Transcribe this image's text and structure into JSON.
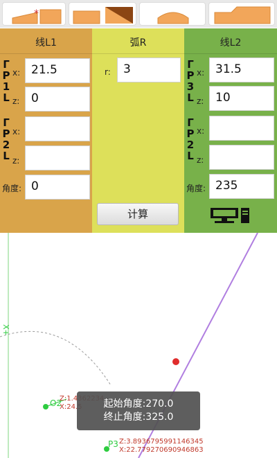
{
  "tabs": [
    {
      "name": "tab-line-chamfer",
      "marker": "*"
    },
    {
      "name": "tab-dual-chamfer"
    },
    {
      "name": "tab-arc"
    },
    {
      "name": "tab-step-chamfer"
    }
  ],
  "panel_l1": {
    "title": "线L1",
    "vertical_p1": [
      "Γ",
      "P",
      "1",
      "L"
    ],
    "vertical_p2": [
      "Γ",
      "P",
      "2",
      "L"
    ],
    "fields": {
      "x1_label": "x:",
      "x1_value": "21.5",
      "z1_label": "z:",
      "z1_value": "0",
      "x2_label": "x:",
      "x2_value": "",
      "z2_label": "z:",
      "z2_value": "",
      "angle_label": "角度:",
      "angle_value": "0"
    }
  },
  "panel_r": {
    "title": "弧R",
    "r_label": "r:",
    "r_value": "3",
    "calc_label": "计算"
  },
  "panel_l2": {
    "title": "线L2",
    "vertical_p3": [
      "Γ",
      "P",
      "3",
      "L"
    ],
    "vertical_p2": [
      "Γ",
      "P",
      "2",
      "L"
    ],
    "fields": {
      "x1_label": "x:",
      "x1_value": "31.5",
      "z1_label": "z:",
      "z1_value": "10",
      "x2_label": "x:",
      "x2_value": "",
      "z2_label": "z:",
      "z2_value": "",
      "angle_label": "角度:",
      "angle_value": "235"
    }
  },
  "drawing": {
    "axis_label": "X+",
    "point_o2": {
      "name": "O2",
      "z": "Z:1.4362234",
      "x": "X:24.5"
    },
    "point_p3": {
      "name": "P3",
      "z": "Z:3.8936795991146345",
      "x": "X:22.779270690946863"
    }
  },
  "toast": {
    "start_angle": "起始角度:270.0",
    "end_angle": "终止角度:325.0"
  },
  "colors": {
    "panel_l1": "#d9a44a",
    "panel_r": "#dde05a",
    "panel_l2": "#78b14a",
    "line": "#b07ee0",
    "point_green": "#2ecc40",
    "point_red": "#e02d2d"
  }
}
